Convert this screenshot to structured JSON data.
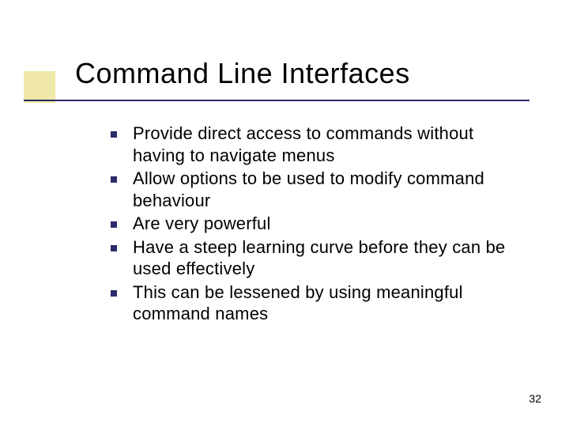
{
  "slide": {
    "title": "Command Line Interfaces",
    "bullets": [
      "Provide direct access to commands without having to navigate menus",
      "Allow options to be used to modify command behaviour",
      "Are very powerful",
      "Have a steep learning curve before they can be used effectively",
      "This can be lessened by using meaningful command names"
    ],
    "page_number": "32"
  }
}
